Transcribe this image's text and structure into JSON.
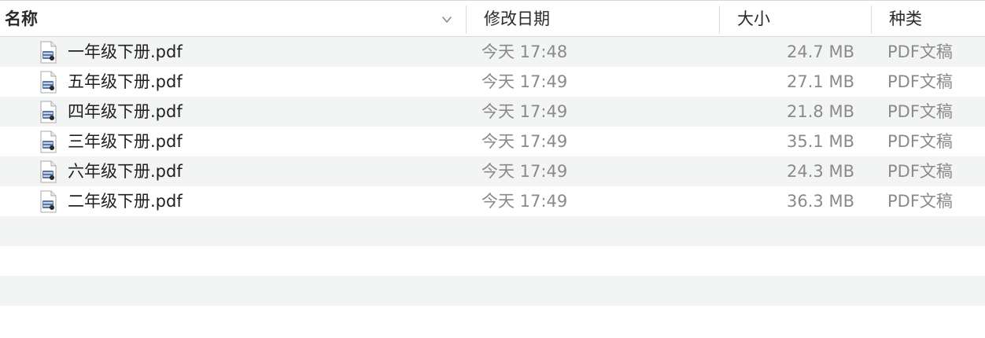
{
  "columns": {
    "name": "名称",
    "date": "修改日期",
    "size": "大小",
    "kind": "种类"
  },
  "sort_indicator_icon": "chevron-down-icon",
  "file_icon": "pdf-document-icon",
  "files": [
    {
      "name": "一年级下册.pdf",
      "modified": "今天 17:48",
      "size": "24.7 MB",
      "kind": "PDF文稿"
    },
    {
      "name": "五年级下册.pdf",
      "modified": "今天 17:49",
      "size": "27.1 MB",
      "kind": "PDF文稿"
    },
    {
      "name": "四年级下册.pdf",
      "modified": "今天 17:49",
      "size": "21.8 MB",
      "kind": "PDF文稿"
    },
    {
      "name": "三年级下册.pdf",
      "modified": "今天 17:49",
      "size": "35.1 MB",
      "kind": "PDF文稿"
    },
    {
      "name": "六年级下册.pdf",
      "modified": "今天 17:49",
      "size": "24.3 MB",
      "kind": "PDF文稿"
    },
    {
      "name": "二年级下册.pdf",
      "modified": "今天 17:49",
      "size": "36.3 MB",
      "kind": "PDF文稿"
    }
  ],
  "colors": {
    "stripe": "#f3f4f4",
    "secondary_text": "#8a8a8a",
    "primary_text": "#1f1f1f"
  }
}
